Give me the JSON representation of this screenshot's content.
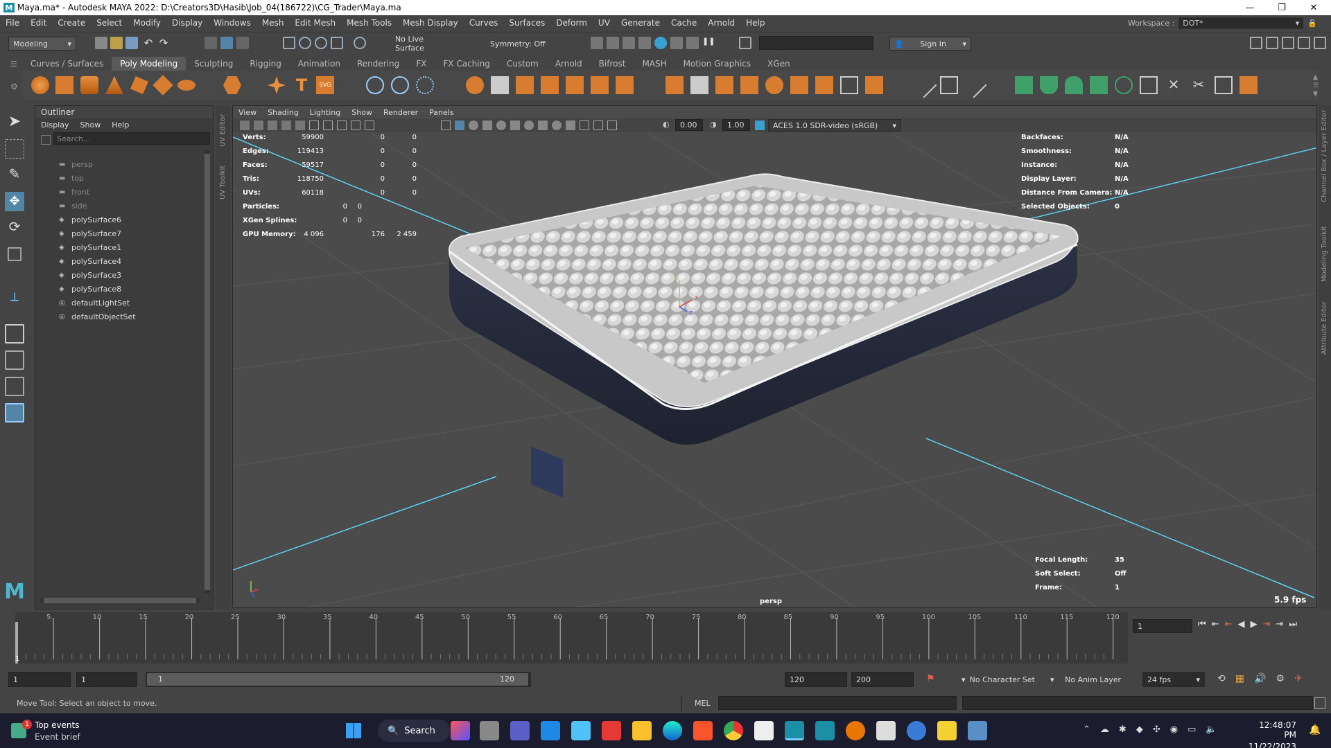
{
  "window": {
    "title": "Maya.ma* - Autodesk MAYA 2022: D:\\Creators3D\\Hasib\\Job_04(186722)\\CG_Trader\\Maya.ma",
    "logo_letter": "M"
  },
  "menubar": {
    "items": [
      "File",
      "Edit",
      "Create",
      "Select",
      "Modify",
      "Display",
      "Windows",
      "Mesh",
      "Edit Mesh",
      "Mesh Tools",
      "Mesh Display",
      "Curves",
      "Surfaces",
      "Deform",
      "UV",
      "Generate",
      "Cache",
      "Arnold",
      "Help"
    ],
    "workspace_label": "Workspace :",
    "workspace_value": "DOT*"
  },
  "statusline": {
    "mode": "Modeling",
    "live_surface": "No Live Surface",
    "symmetry": "Symmetry: Off",
    "sign_in": "Sign In"
  },
  "shelf": {
    "tabs": [
      "Curves / Surfaces",
      "Poly Modeling",
      "Sculpting",
      "Rigging",
      "Animation",
      "Rendering",
      "FX",
      "FX Caching",
      "Custom",
      "Arnold",
      "Bifrost",
      "MASH",
      "Motion Graphics",
      "XGen"
    ],
    "active_tab": 1
  },
  "outliner": {
    "title": "Outliner",
    "menu": [
      "Display",
      "Show",
      "Help"
    ],
    "search_placeholder": "Search...",
    "items": [
      {
        "label": "persp",
        "type": "camera"
      },
      {
        "label": "top",
        "type": "camera"
      },
      {
        "label": "front",
        "type": "camera"
      },
      {
        "label": "side",
        "type": "camera"
      },
      {
        "label": "polySurface6",
        "type": "mesh"
      },
      {
        "label": "polySurface7",
        "type": "mesh"
      },
      {
        "label": "polySurface1",
        "type": "mesh"
      },
      {
        "label": "polySurface4",
        "type": "mesh"
      },
      {
        "label": "polySurface3",
        "type": "mesh"
      },
      {
        "label": "polySurface8",
        "type": "mesh"
      },
      {
        "label": "defaultLightSet",
        "type": "set"
      },
      {
        "label": "defaultObjectSet",
        "type": "set"
      }
    ]
  },
  "side_tabs": {
    "left": [
      "UV Editor",
      "UV Toolkit"
    ],
    "right": [
      "Channel Box / Layer Editor",
      "Modeling Toolkit",
      "Attribute Editor"
    ]
  },
  "viewport": {
    "menu": [
      "View",
      "Shading",
      "Lighting",
      "Show",
      "Renderer",
      "Panels"
    ],
    "exposure": "0.00",
    "gamma": "1.00",
    "color_space": "ACES 1.0 SDR-video (sRGB)",
    "camera": "persp",
    "fps": "5.9 fps",
    "hud_left": [
      {
        "label": "Verts:",
        "v1": "59900",
        "v2": "0",
        "v3": "0"
      },
      {
        "label": "Edges:",
        "v1": "119413",
        "v2": "0",
        "v3": "0"
      },
      {
        "label": "Faces:",
        "v1": "59517",
        "v2": "0",
        "v3": "0"
      },
      {
        "label": "Tris:",
        "v1": "118750",
        "v2": "0",
        "v3": "0"
      },
      {
        "label": "UVs:",
        "v1": "60118",
        "v2": "0",
        "v3": "0"
      },
      {
        "label": "Particles:",
        "v1": "0",
        "v2": "0",
        "v3": ""
      },
      {
        "label": "XGen Splines:",
        "v1": "0",
        "v2": "0",
        "v3": ""
      },
      {
        "label": "GPU Memory:",
        "v1": "4 096",
        "v2": "176",
        "v3": "2 459"
      }
    ],
    "hud_right": [
      {
        "label": "Backfaces:",
        "value": "N/A"
      },
      {
        "label": "Smoothness:",
        "value": "N/A"
      },
      {
        "label": "Instance:",
        "value": "N/A"
      },
      {
        "label": "Display Layer:",
        "value": "N/A"
      },
      {
        "label": "Distance From Camera:",
        "value": "N/A"
      },
      {
        "label": "Selected Objects:",
        "value": "0"
      }
    ],
    "hud_bottom_right": [
      {
        "label": "Focal Length:",
        "value": "35"
      },
      {
        "label": "Soft Select:",
        "value": "Off"
      },
      {
        "label": "Frame:",
        "value": "1"
      }
    ]
  },
  "timeline": {
    "ticks": [
      "5",
      "10",
      "15",
      "20",
      "25",
      "30",
      "35",
      "40",
      "45",
      "50",
      "55",
      "60",
      "65",
      "70",
      "75",
      "80",
      "85",
      "90",
      "95",
      "100",
      "105",
      "110",
      "115",
      "120"
    ],
    "current_frame_marker": "1",
    "current_frame_field": "1"
  },
  "range": {
    "start": "1",
    "playback_start": "1",
    "slider_start": "1",
    "slider_end": "120",
    "playback_end": "120",
    "end": "200",
    "character_set": "No Character Set",
    "anim_layer": "No Anim Layer",
    "fps": "24 fps"
  },
  "cmdline": {
    "help_text": "Move Tool: Select an object to move.",
    "language": "MEL"
  },
  "taskbar": {
    "news_title": "Top events",
    "news_sub": "Event brief",
    "badge": "1",
    "search": "Search",
    "time": "12:48:07 PM",
    "date": "11/22/2023"
  },
  "colors": {
    "viewport_bg": "#4b4b4b",
    "grid_axis": "#5fd0f0",
    "mattress_side": "#262b3a",
    "mattress_top": "#c8c8c8",
    "active_tool": "#5285a6"
  }
}
